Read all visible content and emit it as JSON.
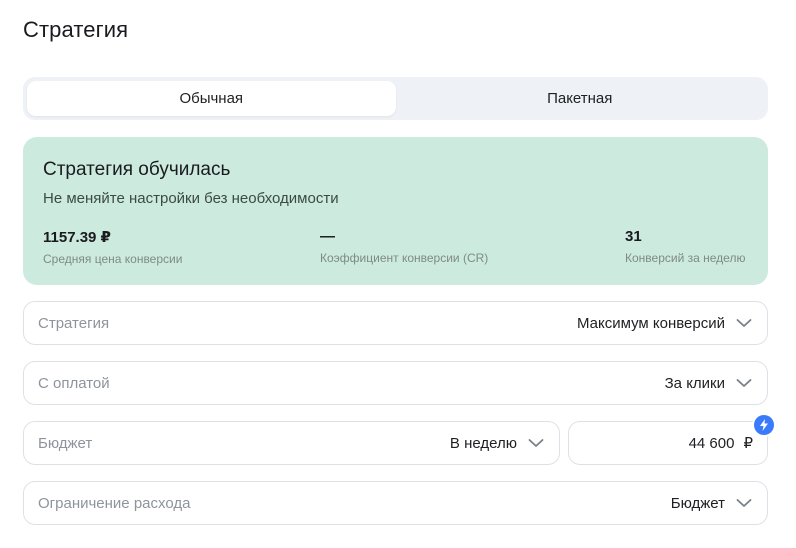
{
  "page": {
    "title": "Стратегия"
  },
  "tabs": [
    {
      "label": "Обычная",
      "active": true
    },
    {
      "label": "Пакетная",
      "active": false
    }
  ],
  "status_card": {
    "title": "Стратегия обучилась",
    "subtitle": "Не меняйте настройки без необходимости",
    "background_color": "#cdeade",
    "stats": [
      {
        "value": "1157.39 ₽",
        "label": "Средняя цена конверсии"
      },
      {
        "value": "—",
        "label": "Коэффициент конверсии (CR)"
      },
      {
        "value": "31",
        "label": "Конверсий за неделю"
      }
    ]
  },
  "fields": {
    "strategy": {
      "label": "Стратегия",
      "value": "Максимум конверсий"
    },
    "payment": {
      "label": "С оплатой",
      "value": "За клики"
    },
    "budget": {
      "label": "Бюджет",
      "value": "В неделю"
    },
    "budget_amount": {
      "value": "44 600",
      "currency": "₽"
    },
    "spend_limit": {
      "label": "Ограничение расхода",
      "value": "Бюджет"
    }
  },
  "icons": {
    "dropdown": "chevron-down-icon",
    "badge": "lightning-icon"
  },
  "accent_color": "#3a7bfb"
}
